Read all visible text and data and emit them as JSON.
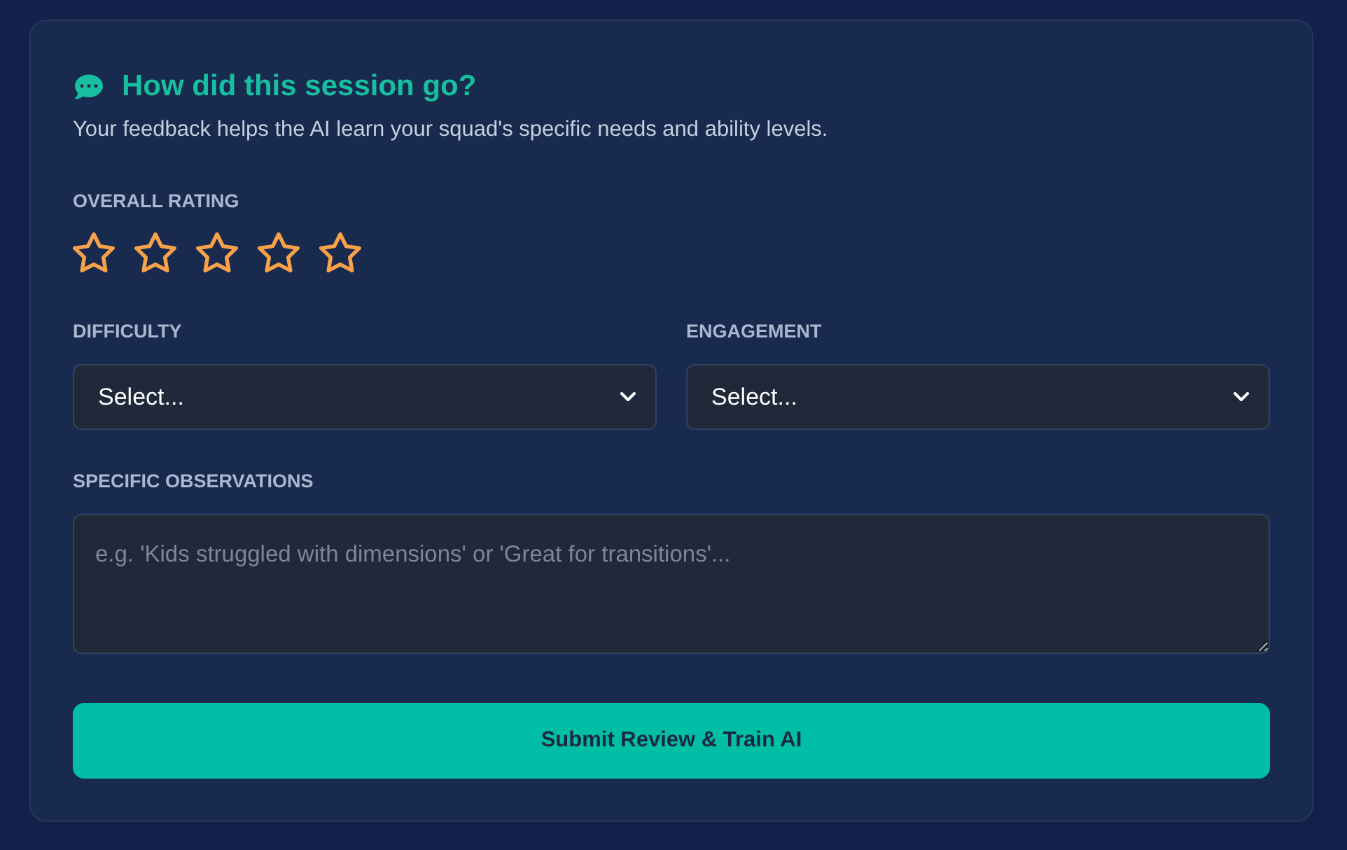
{
  "feedback_card": {
    "title": "How did this session go?",
    "subtitle": "Your feedback helps the AI learn your squad's specific needs and ability levels.",
    "rating": {
      "label": "OVERALL RATING",
      "stars": 0
    },
    "selects": [
      {
        "label": "DIFFICULTY",
        "value": "Select..."
      },
      {
        "label": "ENGAGEMENT",
        "value": "Select..."
      }
    ],
    "observations": {
      "label": "SPECIFIC OBSERVATIONS",
      "placeholder": "e.g. 'Kids struggled with dimensions' or 'Great for transitions'..."
    },
    "submit_button": {
      "label": "Submit Review & Train AI"
    }
  }
}
